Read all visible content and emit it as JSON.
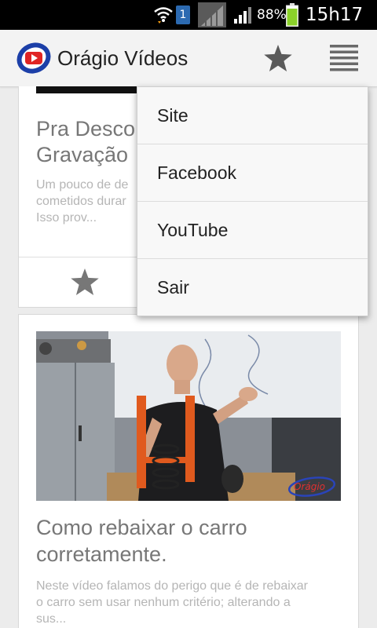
{
  "status_bar": {
    "sim_slot": "1",
    "battery_percent": "88%",
    "clock": "15h17",
    "icons": [
      "wifi-icon",
      "sim-icon",
      "no-signal-icon",
      "signal-icon",
      "battery-icon"
    ]
  },
  "app_bar": {
    "title": "Orágio Vídeos",
    "logo_icon": "play-logo-icon",
    "favorites_icon": "star-icon",
    "menu_icon": "overflow-menu-icon"
  },
  "videos": [
    {
      "title_lines": [
        "Pra Desco",
        "Gravação"
      ],
      "description_lines": [
        "Um pouco de de",
        "cometidos durar",
        "Isso prov..."
      ],
      "favorite_icon": "star-icon"
    },
    {
      "title_lines": [
        "Como rebaixar o carro",
        "corretamente."
      ],
      "description_lines": [
        "Neste vídeo falamos do perigo que é de rebaixar",
        "o carro sem usar nenhum critério; alterando a",
        "sus..."
      ],
      "thumbnail_watermark": "Orágio"
    }
  ],
  "overflow_menu": {
    "items": [
      {
        "label": "Site"
      },
      {
        "label": "Facebook"
      },
      {
        "label": "YouTube"
      },
      {
        "label": "Sair"
      }
    ]
  },
  "colors": {
    "status_bar": "#000000",
    "action_bar": "#f3f3f3",
    "logo_ring": "#1c3fa8",
    "logo_play": "#e02424",
    "battery": "#8bd12a",
    "title_text": "#777777",
    "desc_text": "#b5b5b5"
  }
}
